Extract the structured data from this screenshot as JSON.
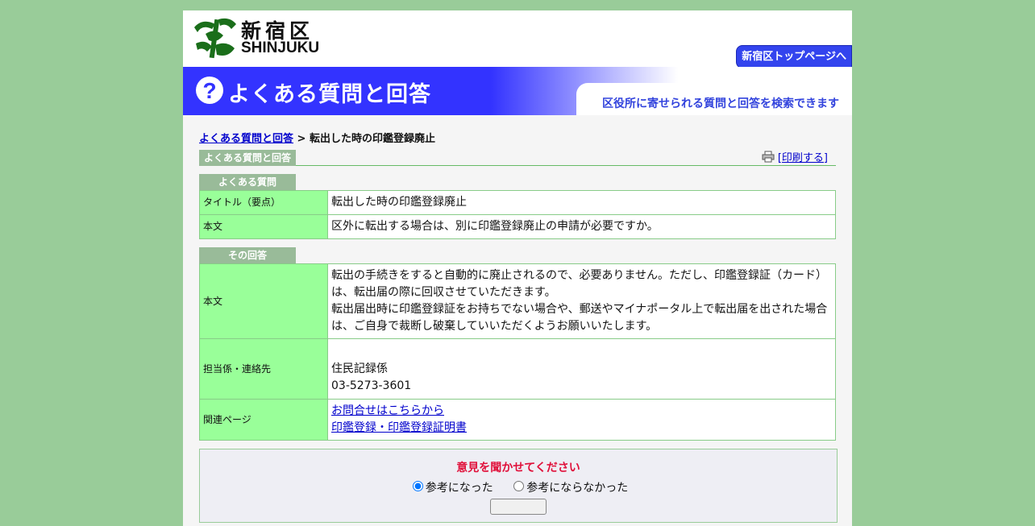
{
  "header": {
    "logo_ja": "新宿区",
    "logo_en": "SHINJUKU",
    "top_link": "新宿区トップページへ"
  },
  "banner": {
    "title": "よくある質問と回答",
    "subtitle": "区役所に寄せられる質問と回答を検索できます"
  },
  "breadcrumb": {
    "link": "よくある質問と回答",
    "separator": " > ",
    "current": "転出した時の印鑑登録廃止"
  },
  "section_tab": "よくある質問と回答",
  "print_label": "[印刷する]",
  "question": {
    "tab": "よくある質問",
    "title_label": "タイトル（要点）",
    "title": "転出した時の印鑑登録廃止",
    "body_label": "本文",
    "body": "区外に転出する場合は、別に印鑑登録廃止の申請が必要ですか。"
  },
  "answer": {
    "tab": "その回答",
    "body_label": "本文",
    "body_line1": "転出の手続きをすると自動的に廃止されるので、必要ありません。ただし、印鑑登録証（カード）は、転出届の際に回収させていただきます。",
    "body_line2": "転出届出時に印鑑登録証をお持ちでない場合や、郵送やマイナポータル上で転出届を出された場合は、ご自身で裁断し破棄していいただくようお願いいたします。",
    "contact_label": "担当係・連絡先",
    "contact_dept": "住民記録係",
    "contact_phone": "03-5273-3601",
    "related_label": "関連ページ",
    "related_links": [
      "お問合せはこちらから",
      "印鑑登録・印鑑登録証明書"
    ]
  },
  "feedback": {
    "title": "意見を聞かせてください",
    "option_yes": "参考になった",
    "option_no": "参考にならなかった"
  },
  "colors": {
    "page_bg": "#99cc99",
    "banner_blue": "#3333ff",
    "label_green": "#99ff99",
    "tab_green": "#99bb99",
    "feedback_title": "#e0103a"
  }
}
